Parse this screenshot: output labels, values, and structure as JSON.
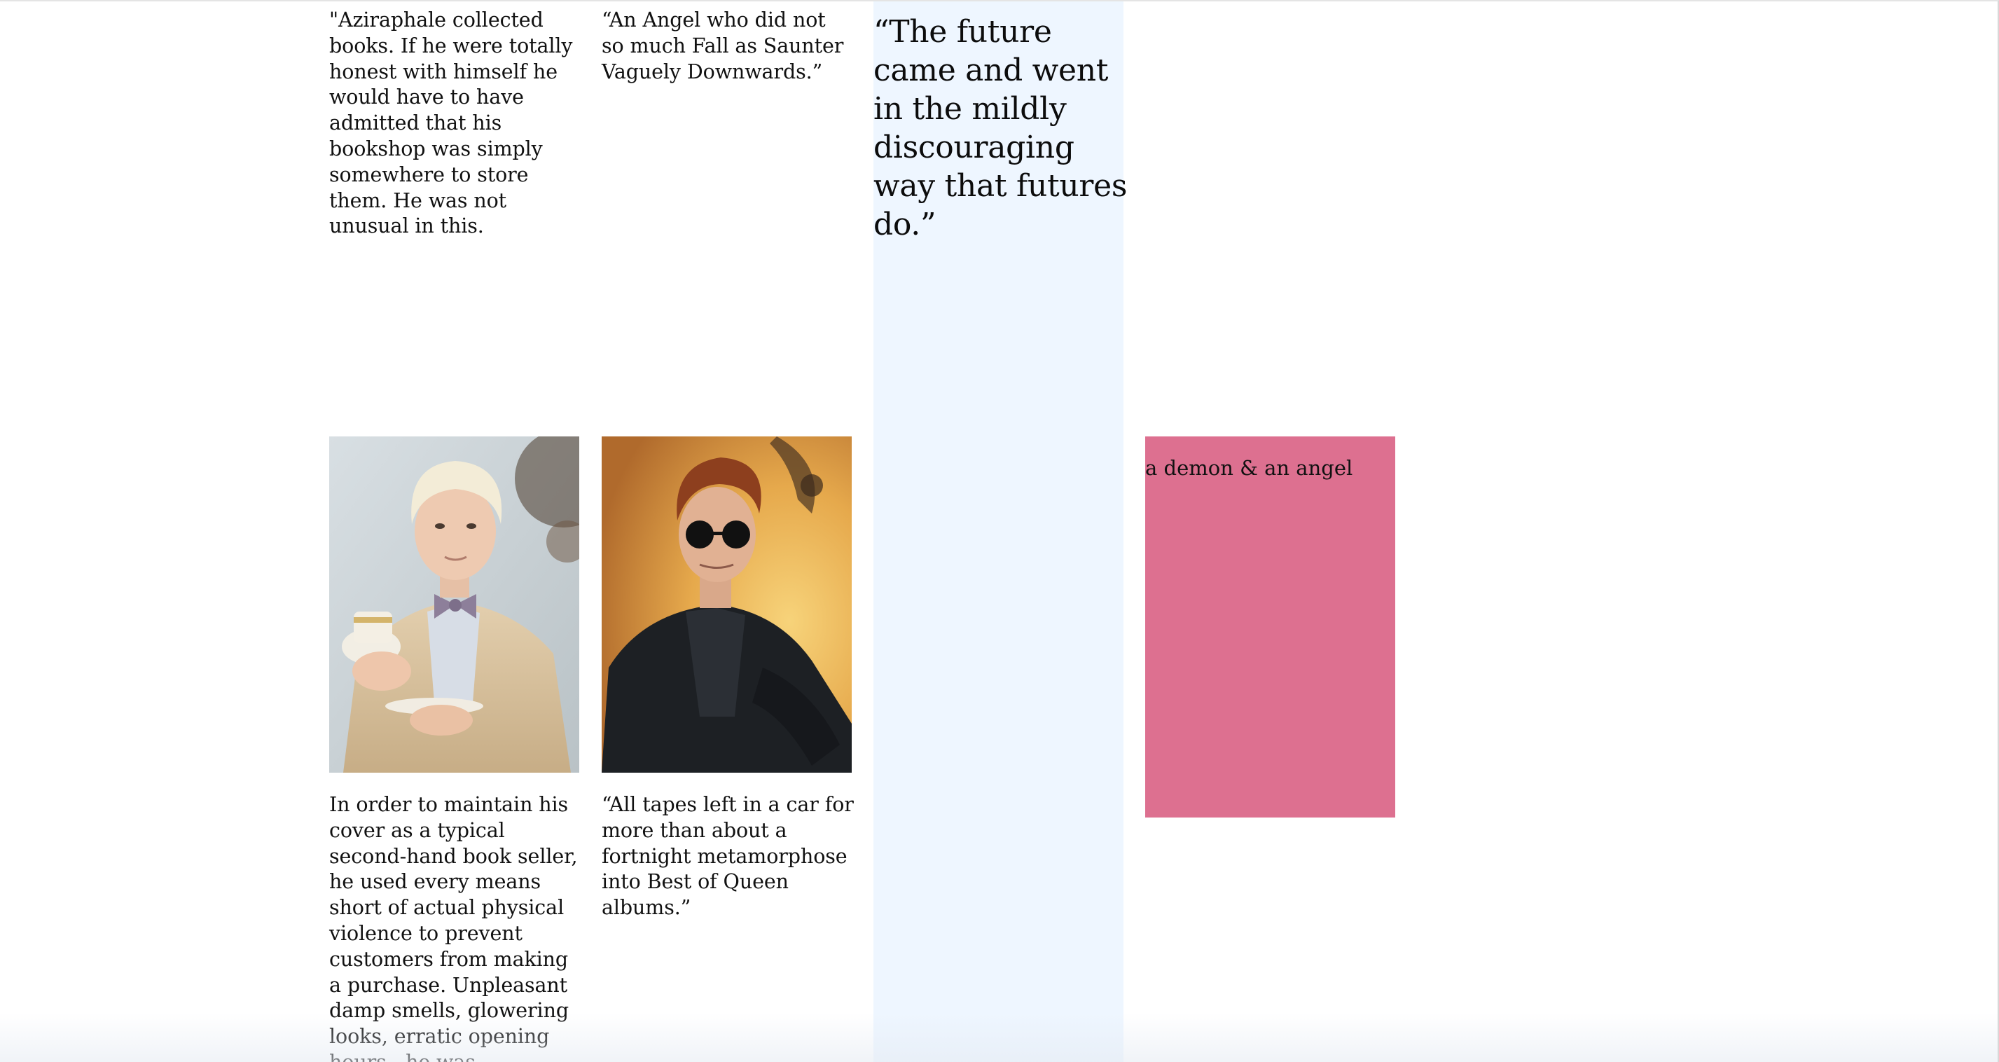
{
  "quotes": {
    "aziraphale_books": "\"Aziraphale collected books. If he were totally honest with himself he would have to have admitted that his bookshop was simply somewhere to store them. He was not unusual in this.",
    "angel_fall": "“An Angel who did not so much Fall as Saunter Vaguely Downwards.”",
    "future": "“The future came and went in the mildly discouraging way that futures do.”",
    "bookseller_cover": "In order to maintain his cover as a typical second-hand book seller, he used every means short of actual physical violence to prevent customers from making a purchase. Unpleasant damp smells, glowering looks, erratic opening hours - he was incredibly good at it.”",
    "tapes": "“All tapes left in a car for more than about a fortnight metamorphose into Best of Queen albums.”"
  },
  "images": {
    "aziraphale": "angel-with-teacup-photo",
    "crowley": "demon-with-sunglasses-photo"
  },
  "pink_card": {
    "caption": "a demon & an angel",
    "color": "#dd7090"
  },
  "quote_column_color": "#eef6ff"
}
